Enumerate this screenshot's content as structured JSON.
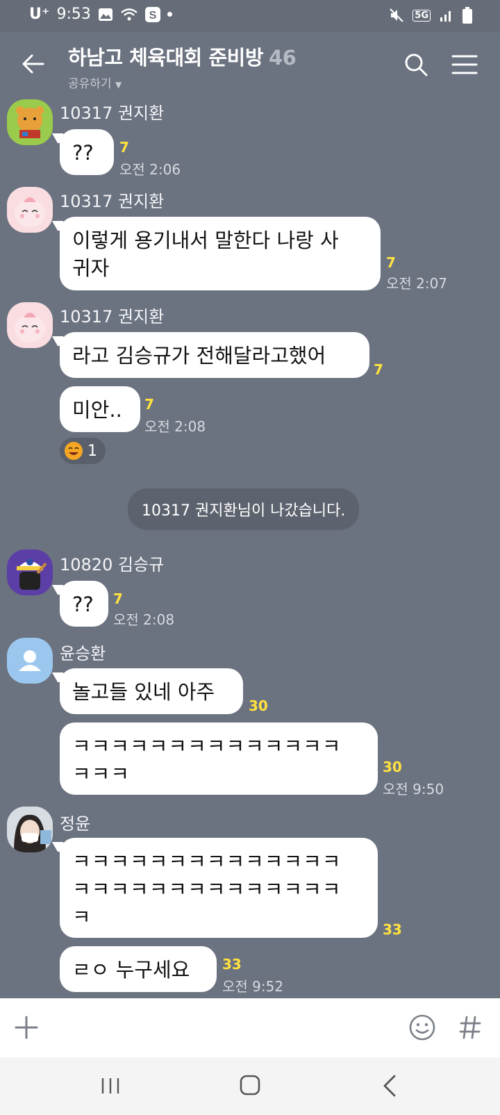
{
  "status": {
    "carrier": "U⁺",
    "time": "9:53",
    "network": "5G"
  },
  "header": {
    "title": "하남고 체육대회 준비방",
    "count": "46",
    "subtitle": "공유하기"
  },
  "messages": {
    "m1": {
      "sender": "10317 권지환",
      "text": "??",
      "unread": "7",
      "time": "오전 2:06"
    },
    "m2": {
      "sender": "10317 권지환",
      "text_l1": "이렇게 용기내서 말한다 나랑 사",
      "text_l2": "귀자",
      "unread": "7",
      "time": "오전 2:07"
    },
    "m3": {
      "sender": "10317 권지환",
      "text": "라고 김승규가 전해달라고했어",
      "unread": "7"
    },
    "m4": {
      "text": "미안..",
      "unread": "7",
      "time": "오전 2:08",
      "reaction_count": "1"
    },
    "system": "10317 권지환님이 나갔습니다.",
    "m5": {
      "sender": "10820 김승규",
      "text": "??",
      "unread": "7",
      "time": "오전 2:08"
    },
    "m6": {
      "sender": "윤승환",
      "text": "놀고들 있네 아주",
      "unread": "30"
    },
    "m7": {
      "text_l1": "ㅋㅋㅋㅋㅋㅋㅋㅋㅋㅋㅋㅋㅋㅋ",
      "text_l2": "ㅋㅋㅋ",
      "unread": "30",
      "time": "오전 9:50"
    },
    "m8": {
      "sender": "정윤",
      "text_l1": "ㅋㅋㅋㅋㅋㅋㅋㅋㅋㅋㅋㅋㅋㅋ",
      "text_l2": "ㅋㅋㅋㅋㅋㅋㅋㅋㅋㅋㅋㅋㅋㅋ",
      "text_l3": "ㅋ",
      "unread": "33"
    },
    "m9": {
      "text": "ㄹㅇ 누구세요",
      "unread": "33",
      "time": "오전 9:52"
    }
  },
  "icons": {
    "back": "back-arrow-icon",
    "search": "search-icon",
    "menu": "menu-icon",
    "plus": "plus-icon",
    "emoji": "emoji-icon",
    "hash": "hashtag-icon"
  },
  "colors": {
    "background": "#6b7280",
    "unread": "#ffe23f"
  }
}
